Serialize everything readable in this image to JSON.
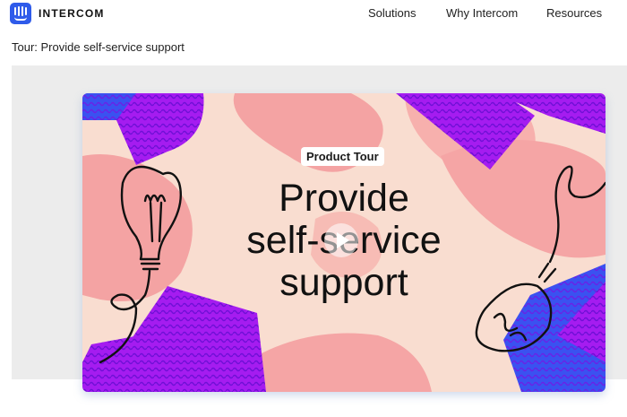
{
  "header": {
    "brand": "INTERCOM",
    "logo_icon": "intercom-logo-icon",
    "nav": [
      "Solutions",
      "Why Intercom",
      "Resources"
    ]
  },
  "page": {
    "title": "Tour: Provide self-service support"
  },
  "video": {
    "badge": "Product Tour",
    "headline": [
      "Provide",
      "self-service",
      "support"
    ],
    "play_icon": "play-icon",
    "colors": {
      "background": "#f9ddd0",
      "blob": "#f4a3a3",
      "purple": "#a51cf0",
      "blue": "#3a52f0"
    }
  }
}
